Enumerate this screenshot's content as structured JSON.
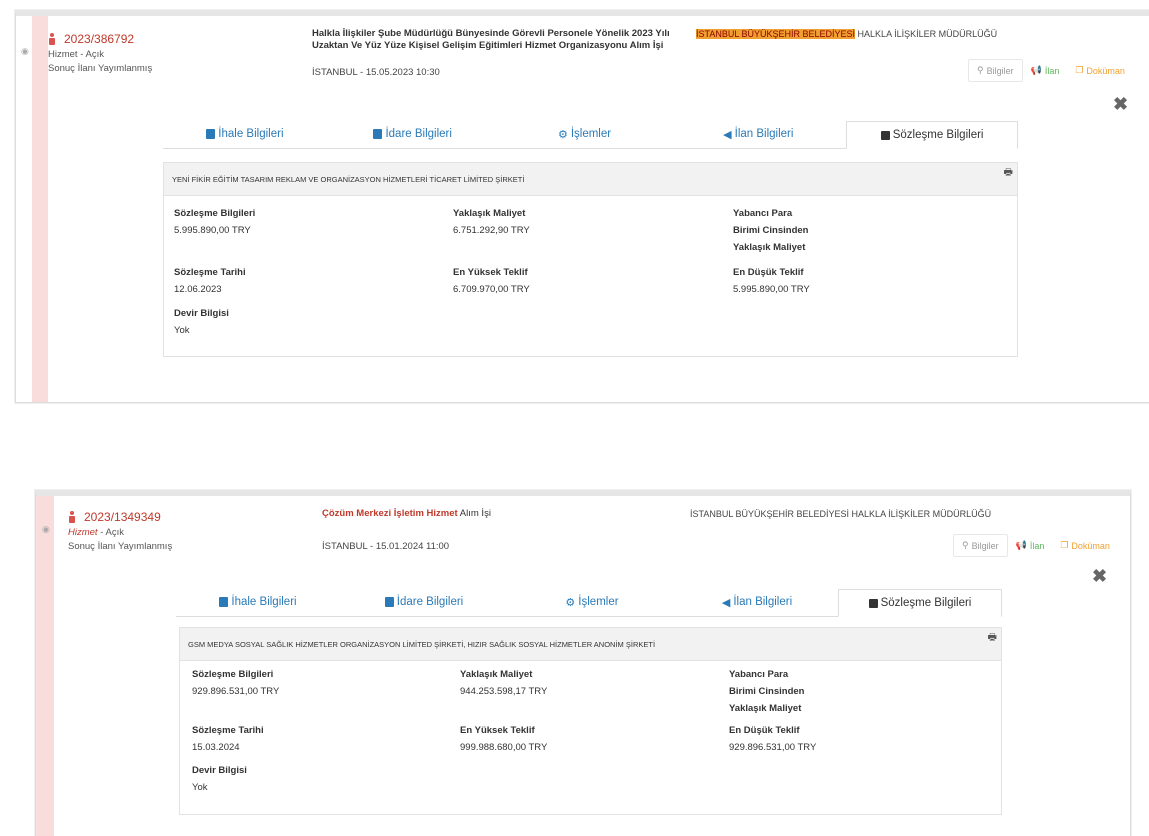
{
  "records": [
    {
      "ref": "2023/386792",
      "type": "Hizmet",
      "status_sep": " - ",
      "status": "Açık",
      "result": "Sonuç İlanı Yayımlanmış",
      "title_line1": "Halkla İlişkiler Şube Müdürlüğü Bünyesinde Görevli Personele Yönelik 2023 Yılı",
      "title_line2": "Uzaktan Ve Yüz Yüze Kişisel Gelişim Eğitimleri Hizmet Organizasyonu Alım İşi",
      "location": "İSTANBUL - 15.05.2023 10:30",
      "agency_highlight": "İSTANBUL BÜYÜKŞEHİR BELEDİYESİ",
      "agency_rest": " HALKLA İLİŞKİLER MÜDÜRLÜĞÜ",
      "actions": {
        "info": "Bilgiler",
        "ilan": "İlan",
        "doc": "Doküman"
      },
      "close": "✖",
      "tabs": [
        "İhale Bilgileri",
        "İdare Bilgileri",
        "İşlemler",
        "İlan Bilgileri",
        "Sözleşme Bilgileri"
      ],
      "company": "YENİ FİKİR EĞİTİM TASARIM REKLAM VE ORGANİZASYON HİZMETLERİ TİCARET LİMİTED ŞİRKETİ",
      "fields": {
        "contract_label": "Sözleşme Bilgileri",
        "contract_value": "5.995.890,00 TRY",
        "approx_label": "Yaklaşık Maliyet",
        "approx_value": "6.751.292,90 TRY",
        "foreign_l1": "Yabancı Para",
        "foreign_l2": "Birimi Cinsinden",
        "foreign_l3": "Yaklaşık Maliyet",
        "date_label": "Sözleşme Tarihi",
        "date_value": "12.06.2023",
        "high_label": "En Yüksek Teklif",
        "high_value": "6.709.970,00 TRY",
        "low_label": "En Düşük Teklif",
        "low_value": "5.995.890,00 TRY",
        "devir_label": "Devir Bilgisi",
        "devir_value": "Yok"
      }
    },
    {
      "ref": "2023/1349349",
      "type": "Hizmet",
      "status_sep": " - ",
      "status": "Açık",
      "result": "Sonuç İlanı Yayımlanmış",
      "title_red": "Çözüm Merkezi İşletim Hizmet",
      "title_plain": " Alım İşi",
      "location": "İSTANBUL - 15.01.2024 11:00",
      "agency_full": "İSTANBUL BÜYÜKŞEHİR BELEDİYESİ HALKLA İLİŞKİLER MÜDÜRLÜĞÜ",
      "actions": {
        "info": "Bilgiler",
        "ilan": "İlan",
        "doc": "Doküman"
      },
      "close": "✖",
      "tabs": [
        "İhale Bilgileri",
        "İdare Bilgileri",
        "İşlemler",
        "İlan Bilgileri",
        "Sözleşme Bilgileri"
      ],
      "company": "GSM MEDYA SOSYAL SAĞLIK HİZMETLER ORGANİZASYON LİMİTED ŞİRKETİ, HIZIR SAĞLIK SOSYAL HİZMETLER ANONİM ŞİRKETİ",
      "fields": {
        "contract_label": "Sözleşme Bilgileri",
        "contract_value": "929.896.531,00 TRY",
        "approx_label": "Yaklaşık Maliyet",
        "approx_value": "944.253.598,17 TRY",
        "foreign_l1": "Yabancı Para",
        "foreign_l2": "Birimi Cinsinden",
        "foreign_l3": "Yaklaşık Maliyet",
        "date_label": "Sözleşme Tarihi",
        "date_value": "15.03.2024",
        "high_label": "En Yüksek Teklif",
        "high_value": "999.988.680,00 TRY",
        "low_label": "En Düşük Teklif",
        "low_value": "929.896.531,00 TRY",
        "devir_label": "Devir Bilgisi",
        "devir_value": "Yok"
      }
    }
  ]
}
